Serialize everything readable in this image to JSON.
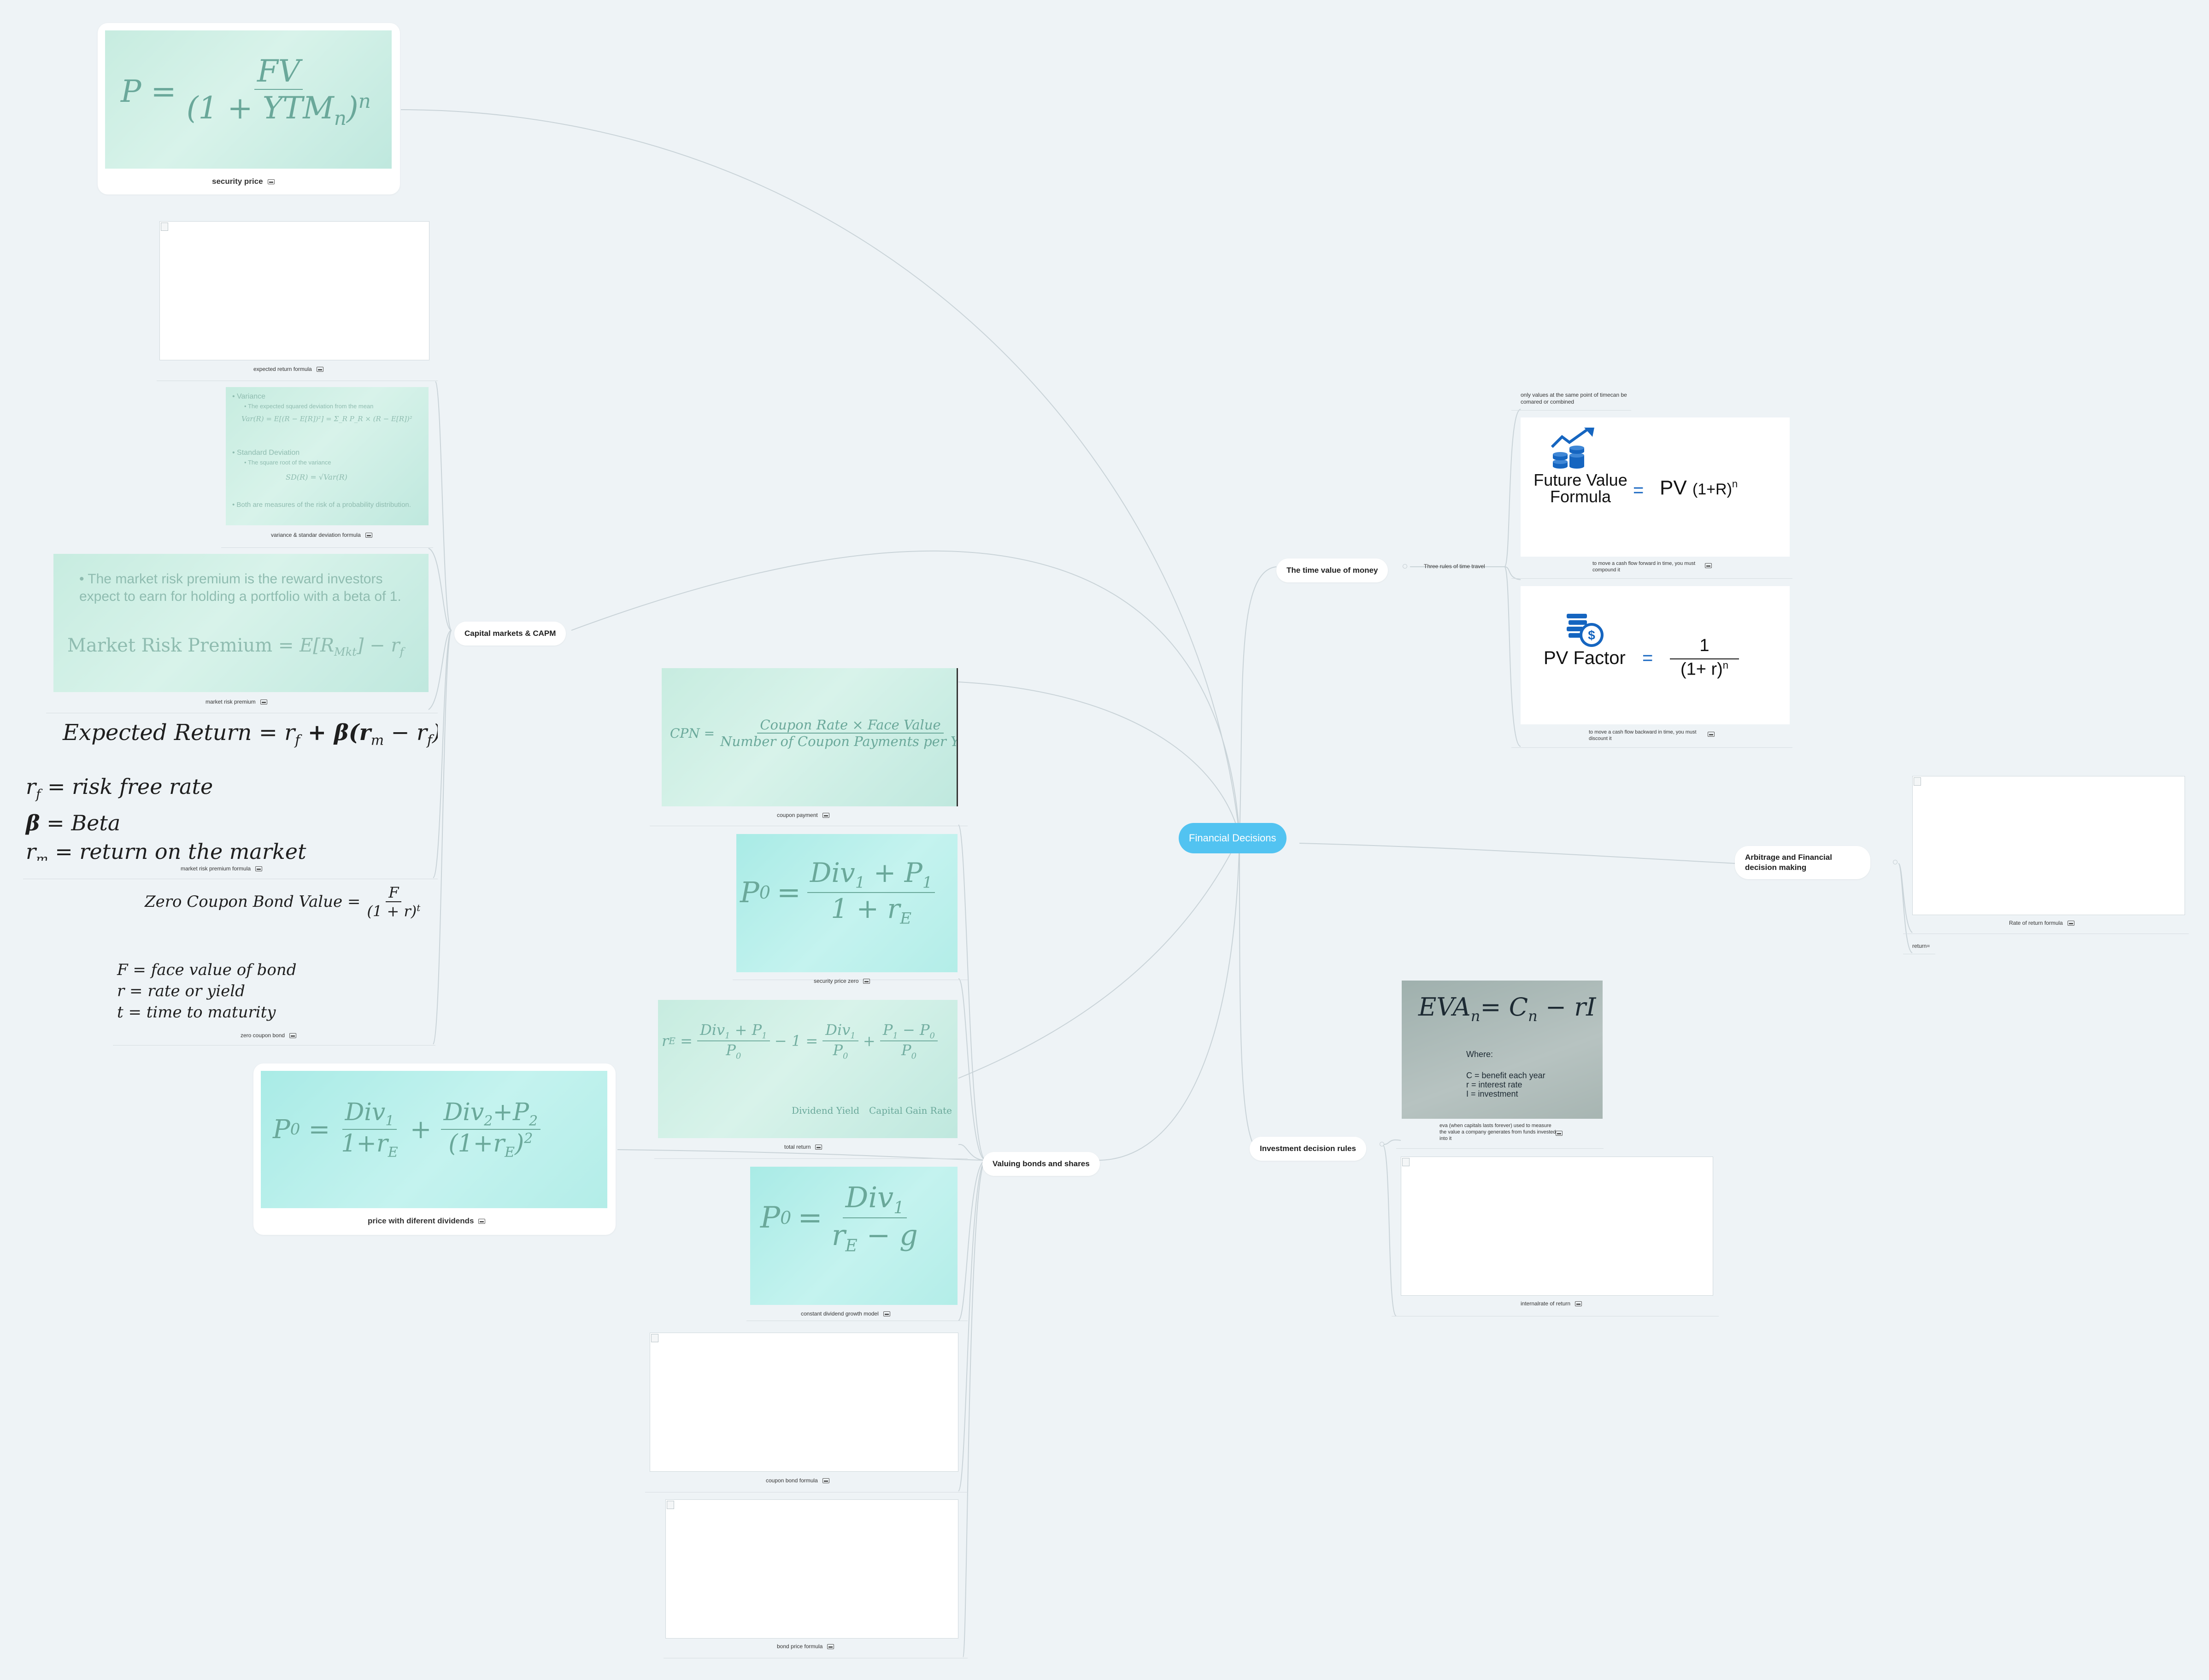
{
  "central": "Financial Decisions",
  "branches": {
    "capm": "Capital markets & CAPM",
    "bonds": "Valuing bonds and shares",
    "tvm": "The time value of money",
    "arbitrage": "Arbitrage and Financial decision making",
    "invest": "Investment decision rules"
  },
  "capm": {
    "security_price": "security price",
    "expected_return_formula": "expected return formula",
    "variance_std": "variance & standar deviation formula",
    "market_risk_premium": "market risk premium",
    "market_risk_premium_formula": "market risk premium formula",
    "zero_coupon_bond": "zero coupon bond",
    "variance_text": {
      "l1": "Variance",
      "l2": "The expected squared deviation from the mean",
      "l3": "Var(R) = E[(R − E[R])²] = Σ_R P_R × (R − E[R])²",
      "l4": "Standard Deviation",
      "l5": "The square root of the variance",
      "l6": "SD(R) = √Var(R)",
      "l7": "Both are measures of the risk of a probability distribution."
    },
    "mrp_text": {
      "bullet": "The market risk premium is the reward investors expect to earn for holding a portfolio with a beta of 1.",
      "formula_left": "Market Risk Premium",
      "formula_right": "= E[R",
      "formula_sub": "Mkt",
      "formula_end": "] − r",
      "formula_end_sub": "f"
    },
    "expected_return_eq": {
      "lhs": "Expected Return",
      "rhs": "= r",
      "rhs_sub": "f",
      "rhs2": " + β(r",
      "rhs2_sub": "m",
      "rhs3": " − r",
      "rhs3_sub": "f",
      "rhs4": ")"
    },
    "er_defs": [
      {
        "sym": "r",
        "sub": "f",
        "def": "= risk free rate"
      },
      {
        "sym": "β",
        "sub": "",
        "def": "= Beta"
      },
      {
        "sym": "r",
        "sub": "m",
        "def": "= return on the market"
      }
    ],
    "zcb_eq": {
      "lhs": "Zero Coupon Bond Value =",
      "num": "F",
      "den": "(1 + r)",
      "exp": "t"
    },
    "zcb_defs": [
      "F =  face value of bond",
      "r = rate or yield",
      "t = time to maturity"
    ],
    "security_price_eq": {
      "lhs": "P =",
      "num": "FV",
      "den": "(1 + YTM",
      "den_sub": "n",
      "den_end": ")",
      "exp": "n"
    }
  },
  "bonds": {
    "coupon_payment": "coupon payment",
    "security_price_zero": "security price zero",
    "total_return": "total return",
    "price_diff_dividends": "price with diferent dividends",
    "constant_dividend": "constant dividend growth model",
    "coupon_bond_formula": "coupon bond formula",
    "bond_price_formula": "bond price formula",
    "cpn_eq": {
      "lhs": "CPN =",
      "num": "Coupon Rate × Face Value",
      "den": "Number of Coupon Payments per Year"
    },
    "p0_eq": {
      "lhs": "P",
      "lhs_sub": "0",
      "eq": "=",
      "num": "Div",
      "num_sub": "1",
      "num_end": " + P",
      "num_end_sub": "1",
      "den": "1 + r",
      "den_sub": "E"
    },
    "total_eq": {
      "lhs": "r",
      "lhs_sub": "E",
      "dividend_yield": "Dividend Yield",
      "capital_gain": "Capital Gain Rate"
    },
    "two_div_eq": {
      "lhs": "P",
      "lhs_sub": "0",
      "n1": "Div",
      "n1_sub": "1",
      "d1": "1+r",
      "d1_sub": "E",
      "n2": "Div",
      "n2_sub": "2",
      "n2_end": "+P",
      "n2_end_sub": "2",
      "d2": "(1+r",
      "d2_sub": "E",
      "d2_end": ")",
      "d2_exp": "2"
    },
    "gordon_eq": {
      "lhs": "P",
      "lhs_sub": "0",
      "num": "Div",
      "num_sub": "1",
      "den": "r",
      "den_sub": "E",
      "den_end": " − g"
    }
  },
  "tvm": {
    "three_rules": "Three rules of time travel",
    "rule1": "only values at the same point of timecan be comared or combined",
    "rule2": "to move a cash flow forward in time, you must compound it",
    "rule3": "to move a cash flow backward in time, you must discount it",
    "fv_title": "Future Value Formula",
    "fv_title_l1": "Future Value",
    "fv_title_l2": "Formula",
    "fv_eq": "=",
    "fv_pv": "PV",
    "fv_base": "(1+R)",
    "fv_exp": "n",
    "pv_title": "PV Factor",
    "pv_eq": "=",
    "pv_num": "1",
    "pv_den": "(1+ r)",
    "pv_exp": "n"
  },
  "arbitrage": {
    "rate_of_return": "Rate of return formula",
    "return": "return="
  },
  "invest": {
    "eva_caption": "eva (when capitals lasts forever) used to measure the value a company generates from funds invested into it",
    "irr": "internalrate of return",
    "eva_eq": {
      "lhs": "EVA",
      "lhs_sub": "n",
      "eq": "= C",
      "eq_sub": "n",
      "end": " − rI"
    },
    "eva_where": "Where:",
    "eva_c": "C = benefit each year",
    "eva_r": "r = interest rate",
    "eva_i": "I = investment"
  },
  "colors": {
    "central": "#52c3f1",
    "background": "#eef3f6",
    "line": "#c9d3d8",
    "icon_blue": "#1565c0"
  }
}
